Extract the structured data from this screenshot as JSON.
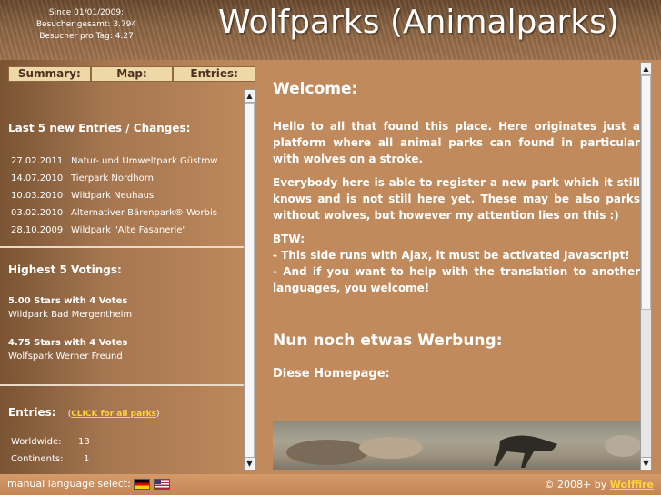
{
  "header": {
    "since": "Since 01/01/2009:",
    "total": "Besucher gesamt: 3.794",
    "per_day": "Besucher pro Tag: 4.27",
    "title": "Wolfparks (Animalparks)"
  },
  "tabs": [
    "Summary:",
    "Map:",
    "Entries:"
  ],
  "left": {
    "new_entries_title": "Last 5 new Entries / Changes:",
    "new_entries": [
      {
        "date": "27.02.2011",
        "name": "Natur- und Umweltpark Güstrow"
      },
      {
        "date": "14.07.2010",
        "name": "Tierpark Nordhorn"
      },
      {
        "date": "10.03.2010",
        "name": "Wildpark Neuhaus"
      },
      {
        "date": "03.02.2010",
        "name": "Alternativer Bärenpark® Worbis"
      },
      {
        "date": "28.10.2009",
        "name": "Wildpark \"Alte Fasanerie\""
      }
    ],
    "votings_title": "Highest 5 Votings:",
    "votings": [
      {
        "stars": "5.00 Stars with 4 Votes",
        "name": "Wildpark Bad Mergentheim"
      },
      {
        "stars": "4.75 Stars with 4 Votes",
        "name": "Wolfspark Werner Freund"
      }
    ],
    "entries_title": "Entries:",
    "entries_link_open": "(",
    "entries_link": "CLICK for all parks",
    "entries_link_close": ")",
    "worldwide_label": "Worldwide:",
    "worldwide_value": "13",
    "continents_label": "Continents:",
    "continents_value": "1"
  },
  "right": {
    "welcome_title": "Welcome:",
    "p1": "Hello to all that found this place. Here originates just a platform where all animal parks can found in particular with wolves on a stroke.",
    "p2": "Everybody here is able to register a new park which it still knows and is not still here yet. These may be also parks without wolves, but however my attention lies on this :)",
    "btw": "BTW:",
    "btw1": "- This side runs with Ajax, it must be activated Javascript!",
    "btw2": "- And if you want to help with the translation to another languages, you welcome!",
    "ad_title": "Nun noch etwas Werbung:",
    "homepage_label": "Diese Homepage:"
  },
  "footer": {
    "lang_label": "manual language select:",
    "copyright": "© 2008+ by",
    "author": "Wolffire"
  },
  "colors": {
    "link": "#ffd23a",
    "tab_bg": "#eed8a8"
  }
}
